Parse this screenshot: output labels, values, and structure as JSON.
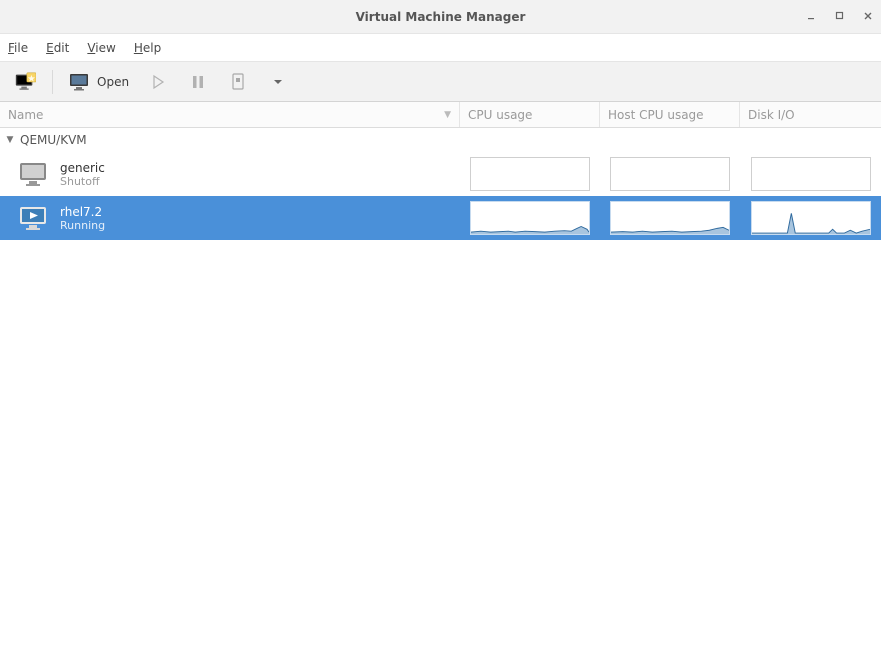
{
  "window": {
    "title": "Virtual Machine Manager"
  },
  "menubar": {
    "file": "File",
    "edit": "Edit",
    "view": "View",
    "help": "Help"
  },
  "toolbar": {
    "open_label": "Open"
  },
  "columns": {
    "name": "Name",
    "cpu": "CPU usage",
    "host": "Host CPU usage",
    "disk": "Disk I/O"
  },
  "connection": {
    "name": "QEMU/KVM"
  },
  "vms": {
    "0": {
      "name": "generic",
      "status": "Shutoff"
    },
    "1": {
      "name": "rhel7.2",
      "status": "Running"
    }
  }
}
